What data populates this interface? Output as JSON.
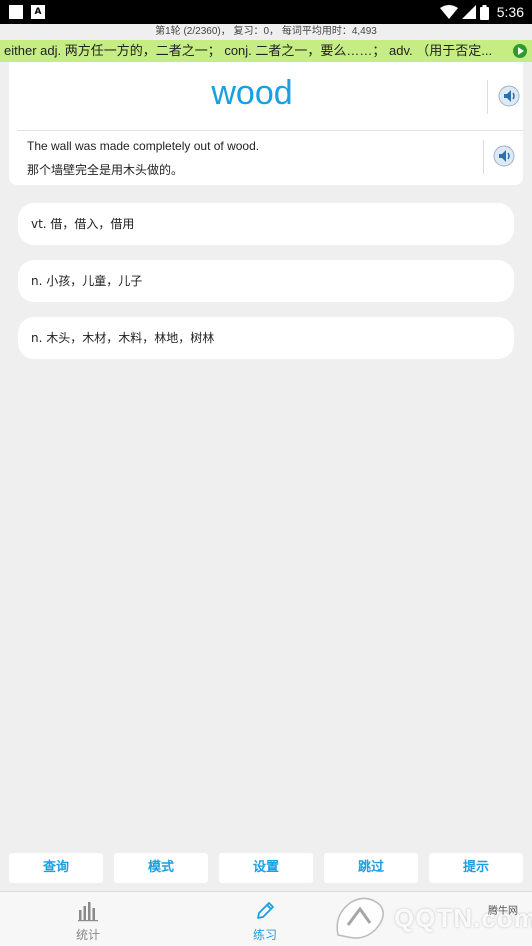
{
  "status_bar": {
    "time": "5:36",
    "notification_glyph": "A"
  },
  "progress": {
    "text": "第1轮 (2/2360)，  复习：0，  每词平均用时：4,493"
  },
  "ticker": {
    "text": "either adj. 两方任一方的，二者之一；  conj. 二者之一，要么……；  adv. （用于否定..."
  },
  "word_card": {
    "word": "wood",
    "example_en": "The wall was made completely out of wood.",
    "example_zh": "那个墙壁完全是用木头做的。"
  },
  "options": [
    {
      "label": "vt. 借，借入，借用"
    },
    {
      "label": "n. 小孩，儿童，儿子"
    },
    {
      "label": "n. 木头，木材，木料，林地，树林"
    }
  ],
  "actions": {
    "lookup": "查询",
    "mode": "模式",
    "settings": "设置",
    "skip": "跳过",
    "hint": "提示"
  },
  "tabs": [
    {
      "label": "统计",
      "icon": "bar-chart-icon"
    },
    {
      "label": "练习",
      "icon": "pencil-icon"
    }
  ],
  "watermark": {
    "text": "QQTN.com",
    "small": "腾牛网"
  },
  "colors": {
    "accent": "#1a9fe0",
    "ticker_bg": "#c6ec84",
    "background": "#efefef"
  }
}
